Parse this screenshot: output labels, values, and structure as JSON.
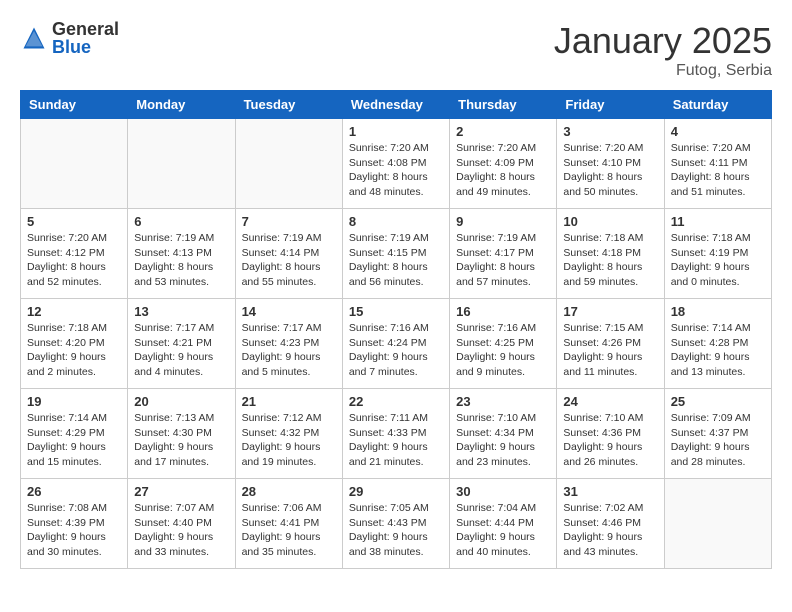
{
  "header": {
    "logo_general": "General",
    "logo_blue": "Blue",
    "month_title": "January 2025",
    "location": "Futog, Serbia"
  },
  "days_of_week": [
    "Sunday",
    "Monday",
    "Tuesday",
    "Wednesday",
    "Thursday",
    "Friday",
    "Saturday"
  ],
  "weeks": [
    [
      {
        "day": "",
        "info": ""
      },
      {
        "day": "",
        "info": ""
      },
      {
        "day": "",
        "info": ""
      },
      {
        "day": "1",
        "info": "Sunrise: 7:20 AM\nSunset: 4:08 PM\nDaylight: 8 hours\nand 48 minutes."
      },
      {
        "day": "2",
        "info": "Sunrise: 7:20 AM\nSunset: 4:09 PM\nDaylight: 8 hours\nand 49 minutes."
      },
      {
        "day": "3",
        "info": "Sunrise: 7:20 AM\nSunset: 4:10 PM\nDaylight: 8 hours\nand 50 minutes."
      },
      {
        "day": "4",
        "info": "Sunrise: 7:20 AM\nSunset: 4:11 PM\nDaylight: 8 hours\nand 51 minutes."
      }
    ],
    [
      {
        "day": "5",
        "info": "Sunrise: 7:20 AM\nSunset: 4:12 PM\nDaylight: 8 hours\nand 52 minutes."
      },
      {
        "day": "6",
        "info": "Sunrise: 7:19 AM\nSunset: 4:13 PM\nDaylight: 8 hours\nand 53 minutes."
      },
      {
        "day": "7",
        "info": "Sunrise: 7:19 AM\nSunset: 4:14 PM\nDaylight: 8 hours\nand 55 minutes."
      },
      {
        "day": "8",
        "info": "Sunrise: 7:19 AM\nSunset: 4:15 PM\nDaylight: 8 hours\nand 56 minutes."
      },
      {
        "day": "9",
        "info": "Sunrise: 7:19 AM\nSunset: 4:17 PM\nDaylight: 8 hours\nand 57 minutes."
      },
      {
        "day": "10",
        "info": "Sunrise: 7:18 AM\nSunset: 4:18 PM\nDaylight: 8 hours\nand 59 minutes."
      },
      {
        "day": "11",
        "info": "Sunrise: 7:18 AM\nSunset: 4:19 PM\nDaylight: 9 hours\nand 0 minutes."
      }
    ],
    [
      {
        "day": "12",
        "info": "Sunrise: 7:18 AM\nSunset: 4:20 PM\nDaylight: 9 hours\nand 2 minutes."
      },
      {
        "day": "13",
        "info": "Sunrise: 7:17 AM\nSunset: 4:21 PM\nDaylight: 9 hours\nand 4 minutes."
      },
      {
        "day": "14",
        "info": "Sunrise: 7:17 AM\nSunset: 4:23 PM\nDaylight: 9 hours\nand 5 minutes."
      },
      {
        "day": "15",
        "info": "Sunrise: 7:16 AM\nSunset: 4:24 PM\nDaylight: 9 hours\nand 7 minutes."
      },
      {
        "day": "16",
        "info": "Sunrise: 7:16 AM\nSunset: 4:25 PM\nDaylight: 9 hours\nand 9 minutes."
      },
      {
        "day": "17",
        "info": "Sunrise: 7:15 AM\nSunset: 4:26 PM\nDaylight: 9 hours\nand 11 minutes."
      },
      {
        "day": "18",
        "info": "Sunrise: 7:14 AM\nSunset: 4:28 PM\nDaylight: 9 hours\nand 13 minutes."
      }
    ],
    [
      {
        "day": "19",
        "info": "Sunrise: 7:14 AM\nSunset: 4:29 PM\nDaylight: 9 hours\nand 15 minutes."
      },
      {
        "day": "20",
        "info": "Sunrise: 7:13 AM\nSunset: 4:30 PM\nDaylight: 9 hours\nand 17 minutes."
      },
      {
        "day": "21",
        "info": "Sunrise: 7:12 AM\nSunset: 4:32 PM\nDaylight: 9 hours\nand 19 minutes."
      },
      {
        "day": "22",
        "info": "Sunrise: 7:11 AM\nSunset: 4:33 PM\nDaylight: 9 hours\nand 21 minutes."
      },
      {
        "day": "23",
        "info": "Sunrise: 7:10 AM\nSunset: 4:34 PM\nDaylight: 9 hours\nand 23 minutes."
      },
      {
        "day": "24",
        "info": "Sunrise: 7:10 AM\nSunset: 4:36 PM\nDaylight: 9 hours\nand 26 minutes."
      },
      {
        "day": "25",
        "info": "Sunrise: 7:09 AM\nSunset: 4:37 PM\nDaylight: 9 hours\nand 28 minutes."
      }
    ],
    [
      {
        "day": "26",
        "info": "Sunrise: 7:08 AM\nSunset: 4:39 PM\nDaylight: 9 hours\nand 30 minutes."
      },
      {
        "day": "27",
        "info": "Sunrise: 7:07 AM\nSunset: 4:40 PM\nDaylight: 9 hours\nand 33 minutes."
      },
      {
        "day": "28",
        "info": "Sunrise: 7:06 AM\nSunset: 4:41 PM\nDaylight: 9 hours\nand 35 minutes."
      },
      {
        "day": "29",
        "info": "Sunrise: 7:05 AM\nSunset: 4:43 PM\nDaylight: 9 hours\nand 38 minutes."
      },
      {
        "day": "30",
        "info": "Sunrise: 7:04 AM\nSunset: 4:44 PM\nDaylight: 9 hours\nand 40 minutes."
      },
      {
        "day": "31",
        "info": "Sunrise: 7:02 AM\nSunset: 4:46 PM\nDaylight: 9 hours\nand 43 minutes."
      },
      {
        "day": "",
        "info": ""
      }
    ]
  ]
}
